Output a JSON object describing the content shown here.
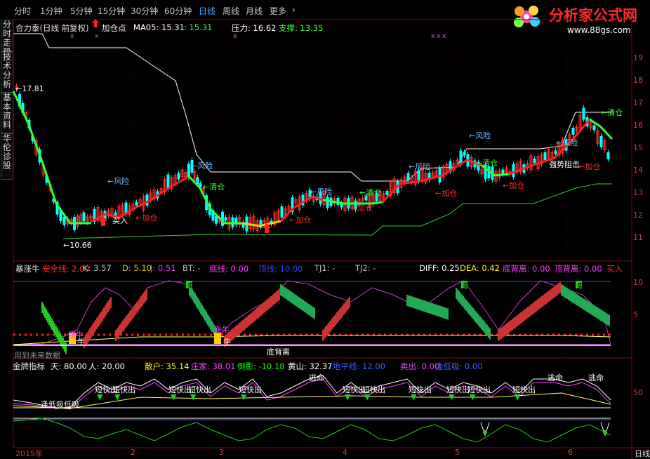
{
  "timeframes": [
    {
      "label": "分时",
      "active": false
    },
    {
      "label": "1分钟",
      "active": false
    },
    {
      "label": "5分钟",
      "active": false
    },
    {
      "label": "15分钟",
      "active": false
    },
    {
      "label": "30分钟",
      "active": false
    },
    {
      "label": "60分钟",
      "active": false
    },
    {
      "label": "日线",
      "active": true
    },
    {
      "label": "周线",
      "active": false
    },
    {
      "label": "月线",
      "active": false
    },
    {
      "label": "更多",
      "active": false
    }
  ],
  "more_chevron": "›",
  "logo": {
    "title": "分析家公式网",
    "url": "www.88gs.com"
  },
  "side_tabs": [
    "分时走势",
    "技术分析",
    "基本资料",
    "华伦诊股"
  ],
  "main_panel": {
    "stock": "合力泰(日线 前复权)",
    "signal": "加仓点",
    "ma_label": "MA05: 15.31",
    "ma_value": ": 15.31",
    "pressure": "压力: 16.62",
    "support": "支撑: 13.35",
    "annotations": {
      "high": "←17.81",
      "low": "←10.66",
      "risk1": "←风险",
      "sell1": "←加仓",
      "buy1": "买入",
      "clear1": "←清仓",
      "risk2": "←风险",
      "risk3": "←风险",
      "risk4": "←风险",
      "clear2": "←清仓",
      "add2": "←加仓",
      "add3": "←加仓",
      "clear3": "←清仓",
      "add4": "←加仓",
      "risk5": "←风险",
      "clear4": "←清仓",
      "risk6": "←风险",
      "block": "强势阻击",
      "clear5": "←清仓",
      "add5": "←加仓",
      "add6": "←加仓"
    },
    "y_axis": [
      "19",
      "18",
      "17",
      "16",
      "15",
      "14",
      "13",
      "12",
      "11"
    ]
  },
  "panel2": {
    "name": "暴涨牛",
    "fields": [
      {
        "k": "安全线: 2.00",
        "color": "#ff3030"
      },
      {
        "k": "K: 3.57",
        "color": "#c0c0c0"
      },
      {
        "k": "D: 5.10",
        "color": "#d0d000"
      },
      {
        "k": "J: 0.51",
        "color": "#e040e0"
      },
      {
        "k": "BT: -",
        "color": "#c0c0c0"
      },
      {
        "k": "底线: 0.00",
        "color": "#ff40ff"
      },
      {
        "k": "顶线: 10.00",
        "color": "#4040ff"
      },
      {
        "k": "TJ1: -",
        "color": "#c0c0c0"
      },
      {
        "k": "TJ2: -",
        "color": "#c0c0c0"
      },
      {
        "k": "DIFF: 0.25",
        "color": "#ffffff"
      },
      {
        "k": "DEA: 0.42",
        "color": "#ffff00"
      },
      {
        "k": "底背离: 0.00",
        "color": "#ff40ff"
      },
      {
        "k": "顶背离: 0.00",
        "color": "#ff40ff"
      },
      {
        "k": "买入",
        "color": "#ff3030"
      }
    ],
    "marks": {
      "sell": "卖",
      "bull": "牛",
      "bull2": "涨牛",
      "divergence": "底背离",
      "use_note": "用到未来数据"
    },
    "y_axis": [
      "10",
      "5"
    ]
  },
  "panel3": {
    "name": "金牌指标",
    "fields": [
      {
        "k": "天: 80.00",
        "color": "#ffffff"
      },
      {
        "k": "人: 20.00",
        "color": "#ffffff"
      },
      {
        "k": "散户: 35.14",
        "color": "#ffff00"
      },
      {
        "k": "庄家: 38.01",
        "color": "#ff40ff"
      },
      {
        "k": "倒影: -10.18",
        "color": "#00ff00"
      },
      {
        "k": "黄山: 32.37",
        "color": "#ffffff"
      },
      {
        "k": "地平线: 12.00",
        "color": "#4060ff"
      },
      {
        "k": "卖出: 0.00",
        "color": "#ff40ff"
      },
      {
        "k": "逢低吸: 0.00",
        "color": "#4060ff"
      }
    ],
    "marks": {
      "quick": "短快出",
      "escape": "逃命",
      "low_buy": "逢低吸",
      "low_buy2": "逢低吸低吸"
    },
    "y_axis": [
      "50"
    ]
  },
  "x_axis": [
    {
      "label": "2015年"
    },
    {
      "label": "2"
    },
    {
      "label": "3"
    },
    {
      "label": "4"
    },
    {
      "label": "5"
    },
    {
      "label": "6"
    }
  ],
  "corner_label": "日线",
  "colors": {
    "up": "#ff3232",
    "down": "#00ffff",
    "bg": "#000000",
    "grid": "#8b0000"
  }
}
